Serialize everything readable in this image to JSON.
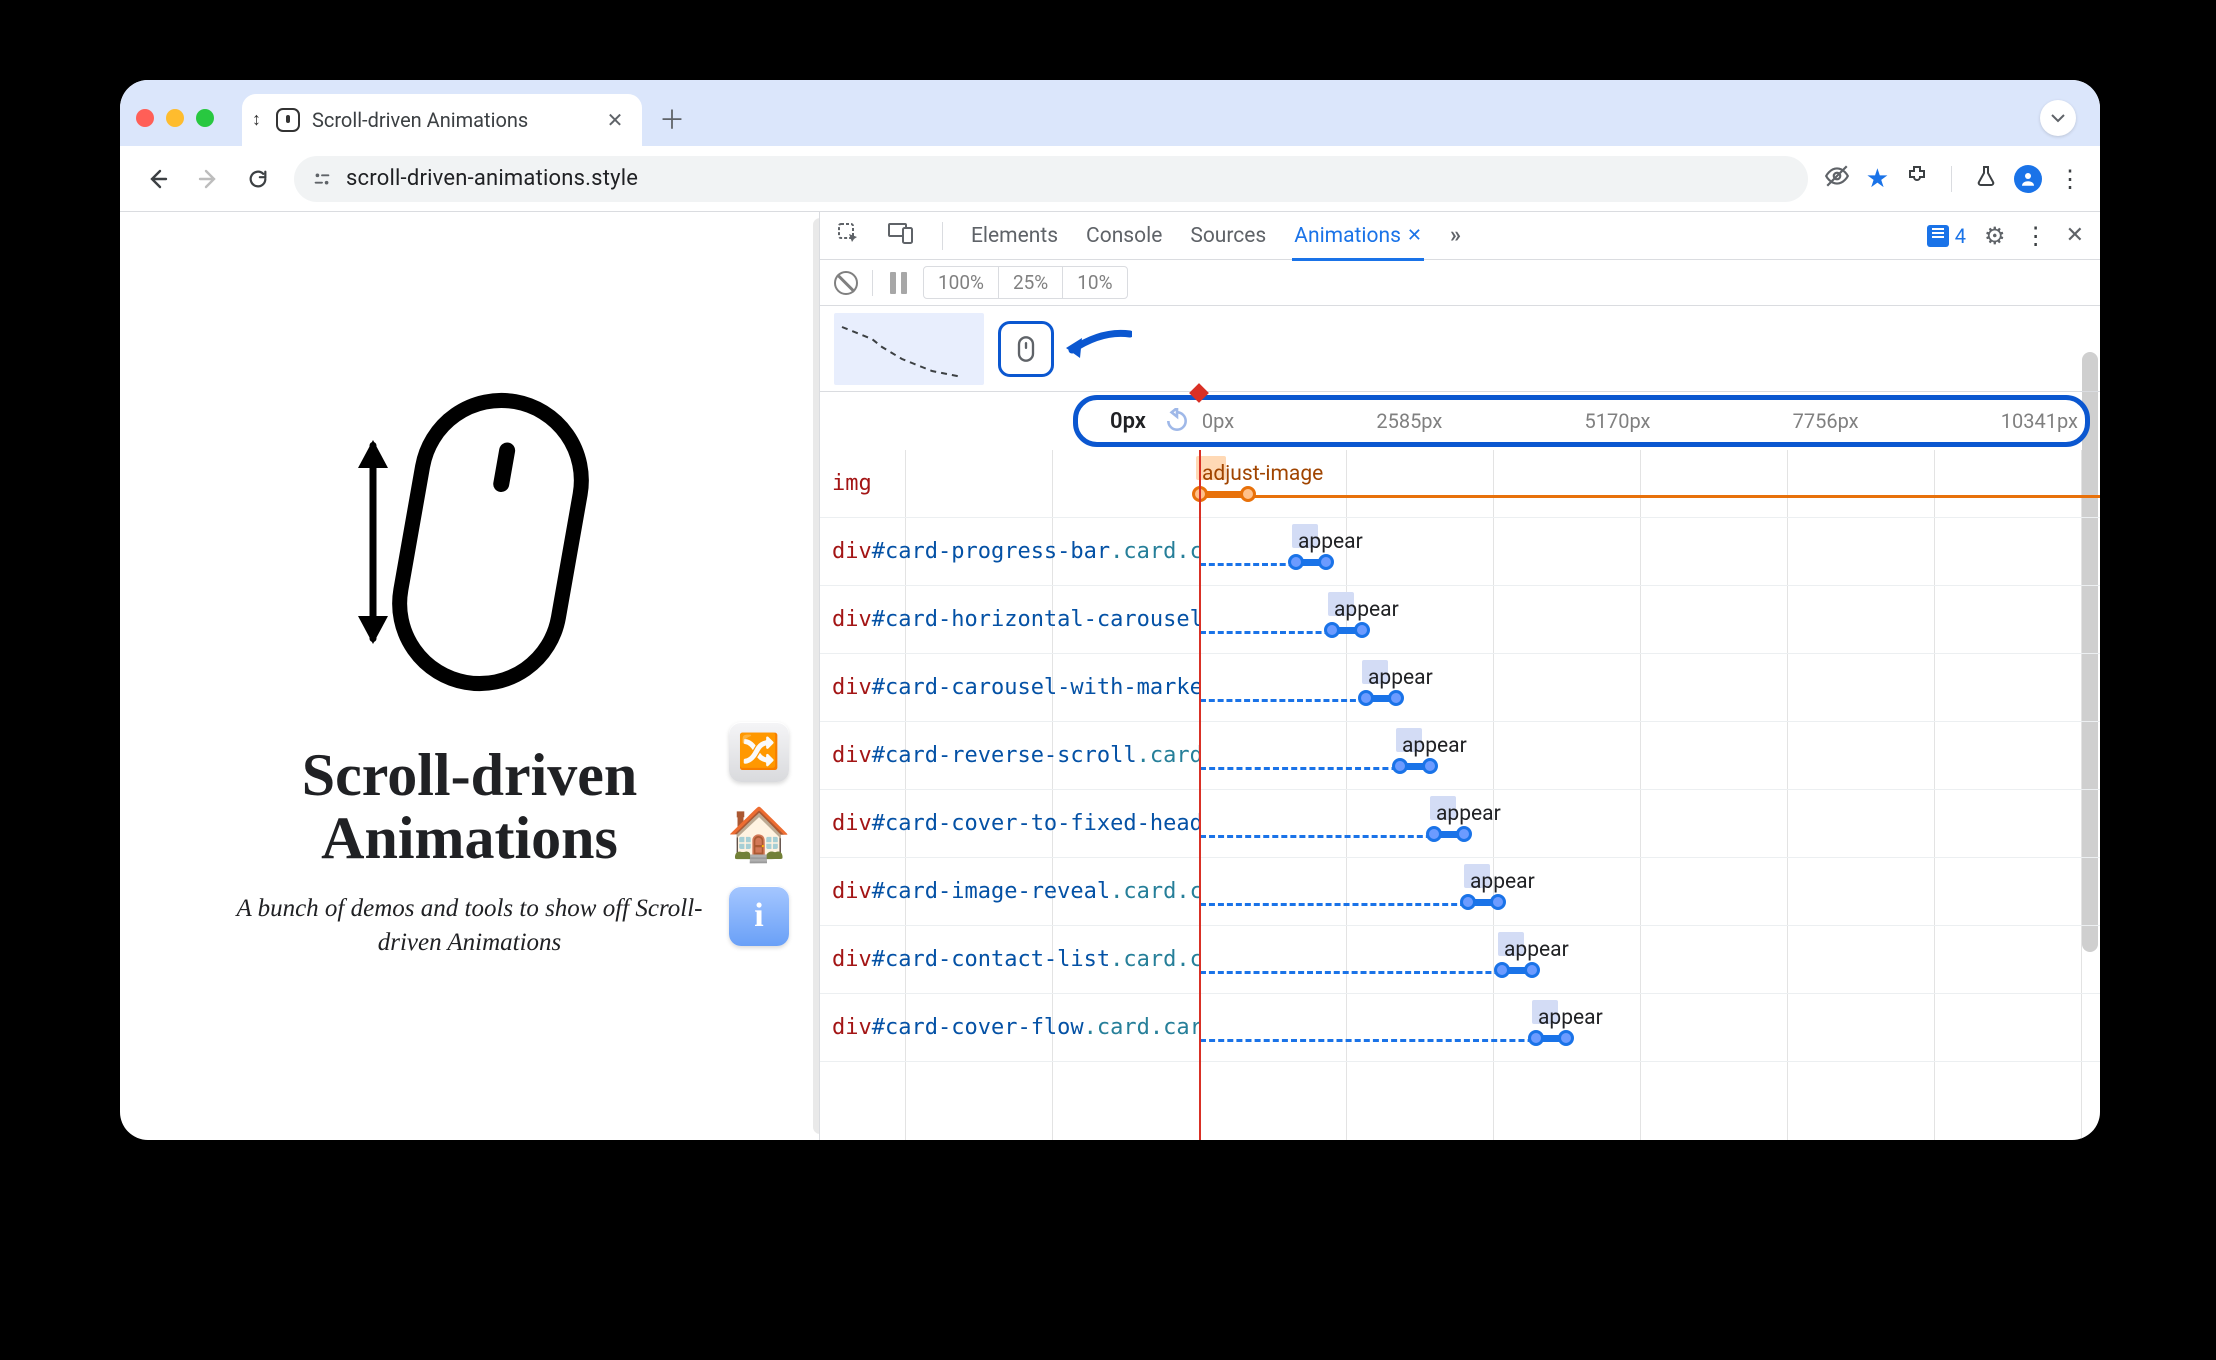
{
  "browser": {
    "tab_title": "Scroll-driven Animations",
    "url": "scroll-driven-animations.style"
  },
  "page": {
    "title_line1": "Scroll-driven",
    "title_line2": "Animations",
    "subtitle": "A bunch of demos and tools to show off Scroll-driven Animations"
  },
  "devtools": {
    "tabs": [
      "Elements",
      "Console",
      "Sources",
      "Animations"
    ],
    "active_tab": "Animations",
    "messages_count": "4",
    "speed_options": [
      "100%",
      "25%",
      "10%"
    ],
    "ruler": {
      "current": "0px",
      "ticks": [
        "0px",
        "2585px",
        "5170px",
        "7756px",
        "10341px"
      ]
    },
    "rows": [
      {
        "tag": "img",
        "id": "",
        "cls": "",
        "anim": "adjust-image",
        "start": 0,
        "d1": 0,
        "d2": 48,
        "shade_w": 30
      },
      {
        "tag": "div",
        "id": "#card-progress-bar",
        "cls": ".card.ca",
        "anim": "appear",
        "start": 0,
        "d1": 96,
        "d2": 126,
        "shade_w": 26
      },
      {
        "tag": "div",
        "id": "#card-horizontal-carousel",
        "cls": ".",
        "anim": "appear",
        "start": 0,
        "d1": 132,
        "d2": 162,
        "shade_w": 26
      },
      {
        "tag": "div",
        "id": "#card-carousel-with-marker",
        "cls": "",
        "anim": "appear",
        "start": 0,
        "d1": 166,
        "d2": 196,
        "shade_w": 26
      },
      {
        "tag": "div",
        "id": "#card-reverse-scroll",
        "cls": ".card.",
        "anim": "appear",
        "start": 0,
        "d1": 200,
        "d2": 230,
        "shade_w": 26
      },
      {
        "tag": "div",
        "id": "#card-cover-to-fixed-heade",
        "cls": "",
        "anim": "appear",
        "start": 0,
        "d1": 234,
        "d2": 264,
        "shade_w": 26
      },
      {
        "tag": "div",
        "id": "#card-image-reveal",
        "cls": ".card.ca",
        "anim": "appear",
        "start": 0,
        "d1": 268,
        "d2": 298,
        "shade_w": 26
      },
      {
        "tag": "div",
        "id": "#card-contact-list",
        "cls": ".card.ca",
        "anim": "appear",
        "start": 0,
        "d1": 302,
        "d2": 332,
        "shade_w": 26
      },
      {
        "tag": "div",
        "id": "#card-cover-flow",
        "cls": ".card.card",
        "anim": "appear",
        "start": 0,
        "d1": 336,
        "d2": 366,
        "shade_w": 26
      }
    ]
  }
}
